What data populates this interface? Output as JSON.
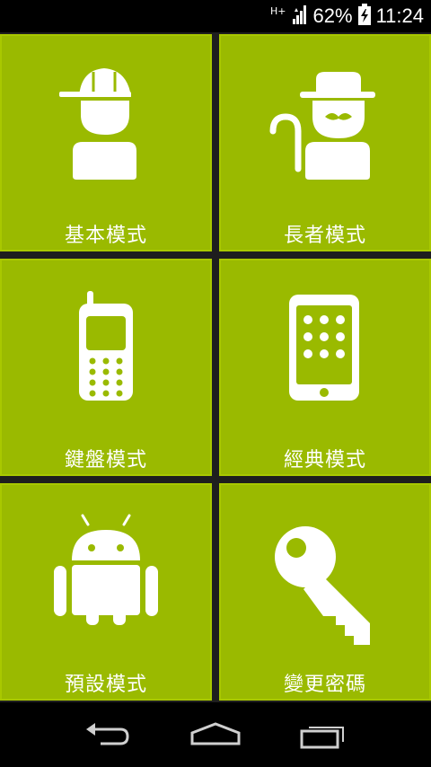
{
  "status_bar": {
    "network": "H+",
    "battery_percent": "62%",
    "time": "11:24",
    "icons": [
      "signal-icon",
      "battery-charging-icon"
    ]
  },
  "tiles": [
    {
      "label": "基本模式",
      "icon": "boy-cap-icon"
    },
    {
      "label": "長者模式",
      "icon": "elder-cane-icon"
    },
    {
      "label": "鍵盤模式",
      "icon": "feature-phone-icon"
    },
    {
      "label": "經典模式",
      "icon": "smartphone-icon"
    },
    {
      "label": "預設模式",
      "icon": "android-robot-icon"
    },
    {
      "label": "變更密碼",
      "icon": "key-icon"
    }
  ],
  "navigation": {
    "buttons": [
      "back-icon",
      "home-icon",
      "recent-apps-icon"
    ]
  },
  "colors": {
    "tile_background": "#9aba00",
    "grid_background": "#1e1e1e",
    "icon_color": "#ffffff"
  }
}
